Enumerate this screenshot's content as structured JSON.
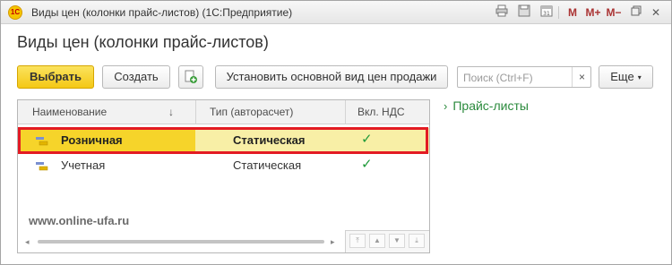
{
  "window": {
    "title": "Виды цен (колонки прайс-листов)  (1С:Предприятие)",
    "logo_text": "1С",
    "toolbar": {
      "m": "M",
      "m_plus": "M+",
      "m_minus": "M−",
      "close": "✕",
      "restore": "▭",
      "minimize": "▁",
      "calendar": "31"
    }
  },
  "form": {
    "title": "Виды цен (колонки прайс-листов)"
  },
  "buttons": {
    "select": "Выбрать",
    "create": "Создать",
    "set_default": "Установить основной вид цен продажи",
    "more": "Еще",
    "more_arrow": "▾"
  },
  "search": {
    "placeholder": "Поиск (Ctrl+F)",
    "clear": "×"
  },
  "table": {
    "columns": [
      "Наименование",
      "Тип (авторасчет)",
      "Вкл. НДС"
    ],
    "sort_indicator": "↓",
    "rows": [
      {
        "name": "Розничная",
        "type": "Статическая",
        "vat": "✓",
        "selected": true
      },
      {
        "name": "Учетная",
        "type": "Статическая",
        "vat": "✓",
        "selected": false
      }
    ]
  },
  "watermark": "www.online-ufa.ru",
  "side_panel": {
    "link": "Прайс-листы",
    "chevron": "›"
  },
  "colors": {
    "primary_button": "#f4c815",
    "selected_row": "#f6d42a",
    "highlight_border": "#e31b23",
    "link": "#2a8a3c",
    "check": "#1f9a3a"
  }
}
